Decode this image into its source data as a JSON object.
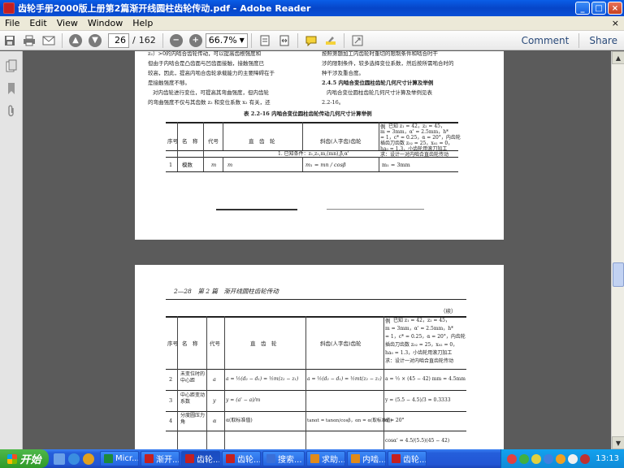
{
  "window": {
    "title": "齿轮手册2000版上册第2篇渐开线圆柱齿轮传动.pdf - Adobe Reader",
    "controls": [
      "_",
      "□",
      "×"
    ]
  },
  "menubar": {
    "items": [
      "File",
      "Edit",
      "View",
      "Window",
      "Help"
    ],
    "close_label": "×"
  },
  "toolbar": {
    "page_current": "26",
    "page_separator": "/",
    "page_total": "162",
    "zoom": "66.7%",
    "comment_label": "Comment",
    "share_label": "Share"
  },
  "document": {
    "page1": {
      "col1": [
        "z₂）>0的内啮合齿轮传动，可以提高齿根强度和",
        "但由于内啮合是凸齿面与凹齿面接触，接触强度已",
        "较高，因此，提高内啮合齿轮承载能力的主要障碍在于",
        "是接触强度不够。",
        "对内齿轮进行变位，可提高其弯曲强度，但内齿轮",
        "的弯曲强度不仅与其齿数 z₂ 和变位系数 x₂ 有关，还"
      ],
      "col2": [
        "按照第题加工内齿轮时重切的限制条件和啮合时干",
        "涉的限制条件，较多选择变位系数，然后按所需啮合时的",
        "种干涉及重合度。",
        "2.4.5  内啮合变位圆柱齿轮几何尺寸计算及举例",
        "内啮合变位圆柱齿轮几何尺寸计算及举例见表",
        "2.2-16。"
      ],
      "table_title": "表 2.2-16  内啮合变位圆柱齿轮传动几何尺寸计算举例",
      "headers": [
        "序号",
        "名　称",
        "代号",
        "直　齿　轮",
        "斜齿(人字齿)齿轮",
        "例"
      ],
      "example": [
        "已知 z₁ = 42，z₂ = 45，",
        "m = 3mm，α' = 2.5mm，h*",
        "= 1，c* = 0.25，α = 20°，内齿轮",
        "插齿刀齿数 z₀₂ = 25，x₀₂ = 0，",
        "ha₀ = 1.3，小齿轮用滚刀加工",
        "求：设计一对内啮合直齿轮传动"
      ],
      "condition": "1. 已知条件：z₁,z₂,m,(mn),β,α'",
      "row1": {
        "no": "1",
        "name": "模数",
        "code": "m",
        "spur": "m",
        "helical": "m₁ = mn / cosβ",
        "example": "m₁ = 3mm"
      }
    },
    "page2": {
      "header": "2—28　第 2 篇　渐开线圆柱齿轮传动",
      "continued": "（续）",
      "headers": [
        "序号",
        "名　称",
        "代号",
        "直　齿　轮",
        "斜齿(人字齿)齿轮",
        "例"
      ],
      "example": [
        "已知 z₁ = 42，z₂ = 45，",
        "m = 3mm，α' = 2.5mm，h*",
        "= 1，c* = 0.25，α = 20°，内齿轮",
        "插齿刀齿数 z₀₂ = 25，x₀₂ = 0，",
        "ha₀ = 1.3，小齿轮用滚刀加工",
        "求：设计一对内啮合直齿轮传动"
      ],
      "rows": [
        {
          "no": "2",
          "name": "未变位时的中心距",
          "code": "a",
          "spur": "a = ½(d₂ − d₁) = ½m(z₂ − z₁)",
          "helical": "a = ½(d₂ − d₁) = ½mt(z₂ − z₁)",
          "example": "a = ½ × (45 − 42) mm = 4.5mm"
        },
        {
          "no": "3",
          "name": "中心距变动系数",
          "code": "y",
          "spur": "y = (a' − a)/m",
          "helical": "",
          "example": "y = (5.5 − 4.5)/3 = 0.3333"
        },
        {
          "no": "4",
          "name": "分度圆压力角",
          "code": "α",
          "spur": "α(取标准值)",
          "helical": "tanαt = tanαn/cosβ，αn = α(取标准值)",
          "example": "α = 20°"
        },
        {
          "no": "",
          "name": "",
          "code": "",
          "spur": "",
          "helical": "",
          "example": "cosα' = 4.5/(5.5)(45 − 42)"
        }
      ]
    }
  },
  "taskbar": {
    "start_label": "开始",
    "tasks": [
      {
        "label": "Micr...",
        "color": "#1e8a3a"
      },
      {
        "label": "渐开...",
        "color": "#c42020"
      },
      {
        "label": "齿轮...",
        "color": "#c42020"
      },
      {
        "label": "齿轮...",
        "color": "#c42020"
      },
      {
        "label": "搜索...",
        "color": "#3a6fd8"
      },
      {
        "label": "求助...",
        "color": "#e08a1a"
      },
      {
        "label": "内啮...",
        "color": "#e08a1a"
      },
      {
        "label": "齿轮...",
        "color": "#c42020"
      }
    ],
    "clock": "13:13"
  }
}
